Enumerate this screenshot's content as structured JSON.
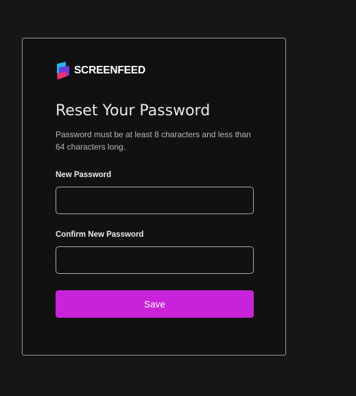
{
  "brand": {
    "name": "SCREENFEED",
    "icon": "screenfeed-logo-icon"
  },
  "form": {
    "title": "Reset Your Password",
    "hint": "Password must be at least 8 characters and less than 64 characters long.",
    "new_password": {
      "label": "New Password",
      "value": "",
      "placeholder": ""
    },
    "confirm_password": {
      "label": "Confirm New Password",
      "value": "",
      "placeholder": ""
    },
    "save_label": "Save"
  },
  "colors": {
    "page_background": "#161616",
    "card_background": "#111111",
    "card_border": "#9b9b9b",
    "accent": "#c823d8",
    "logo_cyan": "#21b7e6",
    "logo_purple": "#6a3ce0",
    "logo_pink": "#e6356f"
  }
}
